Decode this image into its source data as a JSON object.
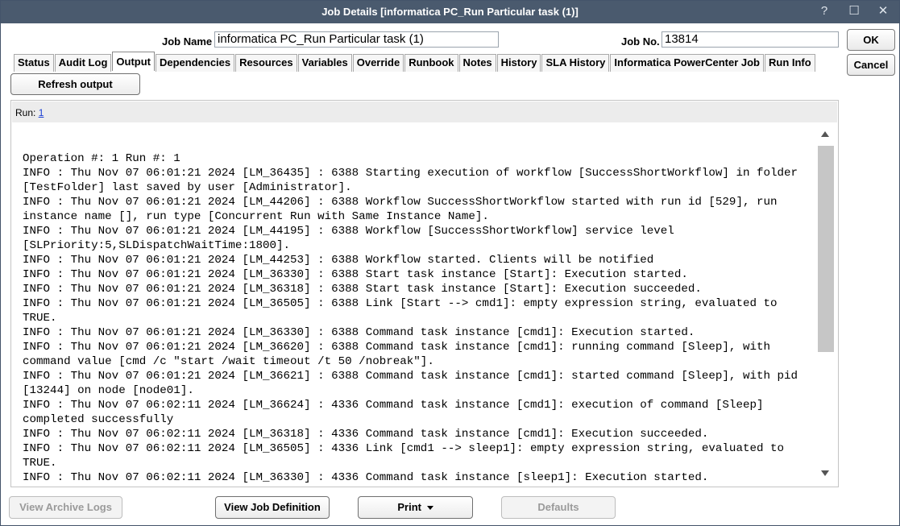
{
  "window": {
    "title": "Job Details [informatica PC_Run Particular task (1)]",
    "help_glyph": "?",
    "maximize_glyph": "☐",
    "close_glyph": "✕"
  },
  "header": {
    "job_name_label": "Job Name",
    "job_name_value": "informatica PC_Run Particular task (1)",
    "job_no_label": "Job No.",
    "job_no_value": "13814",
    "ok_label": "OK",
    "cancel_label": "Cancel"
  },
  "tabs": [
    {
      "label": "Status"
    },
    {
      "label": "Audit Log"
    },
    {
      "label": "Output"
    },
    {
      "label": "Dependencies"
    },
    {
      "label": "Resources"
    },
    {
      "label": "Variables"
    },
    {
      "label": "Override"
    },
    {
      "label": "Runbook"
    },
    {
      "label": "Notes"
    },
    {
      "label": "History"
    },
    {
      "label": "SLA History"
    },
    {
      "label": "Informatica PowerCenter Job"
    },
    {
      "label": "Run Info"
    }
  ],
  "active_tab": "Output",
  "output": {
    "refresh_label": "Refresh output",
    "run_label": "Run:",
    "run_link": "1",
    "log_lines": [
      "Operation #: 1 Run #: 1",
      "INFO : Thu Nov 07 06:01:21 2024 [LM_36435] : 6388 Starting execution of workflow [SuccessShortWorkflow] in folder",
      "[TestFolder] last saved by user [Administrator].",
      "INFO : Thu Nov 07 06:01:21 2024 [LM_44206] : 6388 Workflow SuccessShortWorkflow started with run id [529], run",
      "instance name [], run type [Concurrent Run with Same Instance Name].",
      "INFO : Thu Nov 07 06:01:21 2024 [LM_44195] : 6388 Workflow [SuccessShortWorkflow] service level",
      "[SLPriority:5,SLDispatchWaitTime:1800].",
      "INFO : Thu Nov 07 06:01:21 2024 [LM_44253] : 6388 Workflow started. Clients will be notified",
      "INFO : Thu Nov 07 06:01:21 2024 [LM_36330] : 6388 Start task instance [Start]: Execution started.",
      "INFO : Thu Nov 07 06:01:21 2024 [LM_36318] : 6388 Start task instance [Start]: Execution succeeded.",
      "INFO : Thu Nov 07 06:01:21 2024 [LM_36505] : 6388 Link [Start --> cmd1]: empty expression string, evaluated to",
      "TRUE.",
      "INFO : Thu Nov 07 06:01:21 2024 [LM_36330] : 6388 Command task instance [cmd1]: Execution started.",
      "INFO : Thu Nov 07 06:01:21 2024 [LM_36620] : 6388 Command task instance [cmd1]: running command [Sleep], with",
      "command value [cmd /c \"start /wait timeout /t 50 /nobreak\"].",
      "INFO : Thu Nov 07 06:01:21 2024 [LM_36621] : 6388 Command task instance [cmd1]: started command [Sleep], with pid",
      "[13244] on node [node01].",
      "INFO : Thu Nov 07 06:02:11 2024 [LM_36624] : 4336 Command task instance [cmd1]: execution of command [Sleep]",
      "completed successfully",
      "INFO : Thu Nov 07 06:02:11 2024 [LM_36318] : 4336 Command task instance [cmd1]: Execution succeeded.",
      "INFO : Thu Nov 07 06:02:11 2024 [LM_36505] : 4336 Link [cmd1 --> sleep1]: empty expression string, evaluated to",
      "TRUE.",
      "INFO : Thu Nov 07 06:02:11 2024 [LM_36330] : 4336 Command task instance [sleep1]: Execution started."
    ]
  },
  "footer": {
    "view_archive_logs_label": "View Archive Logs",
    "view_job_definition_label": "View Job Definition",
    "print_label": "Print",
    "defaults_label": "Defaults"
  },
  "colors": {
    "titlebar": "#4a5a6e",
    "link": "#1a3fd3",
    "scroll_thumb": "#c6c6c6"
  }
}
